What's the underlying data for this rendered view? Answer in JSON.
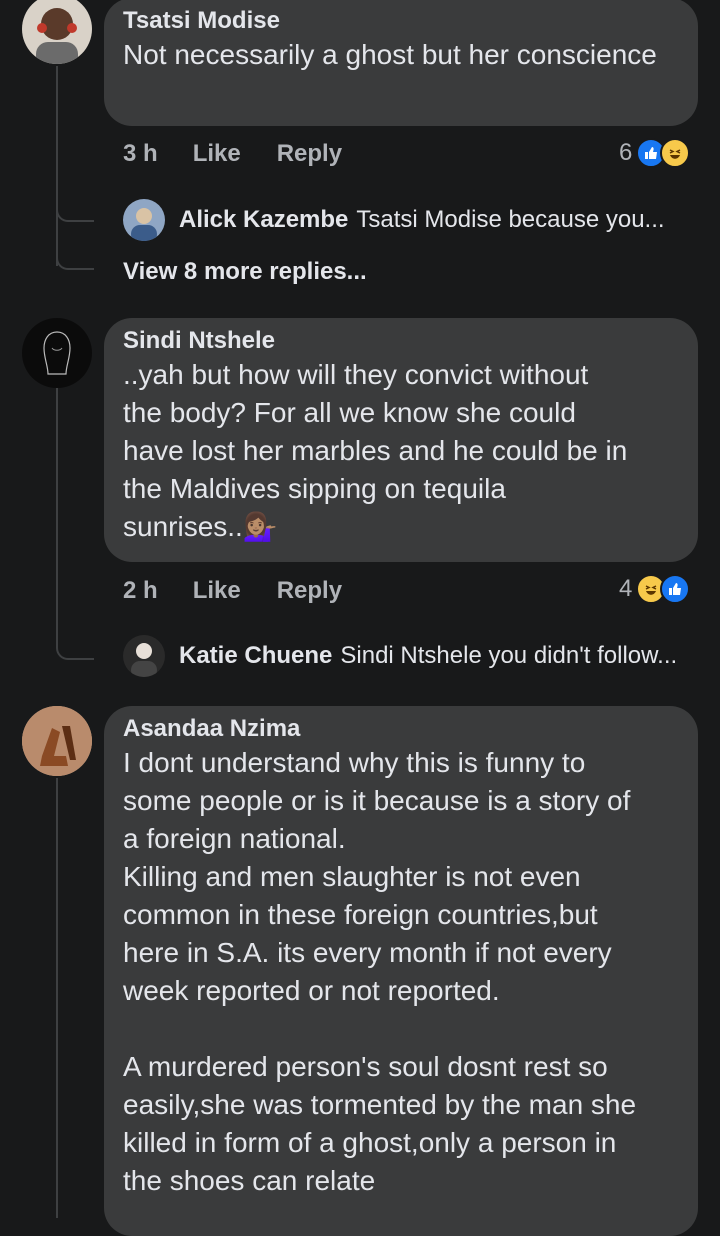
{
  "comments": [
    {
      "author": "Tsatsi Modise",
      "text": "Not necessarily a ghost but her conscience",
      "time": "3 h",
      "like": "Like",
      "reply": "Reply",
      "reaction_count": "6",
      "reactions": [
        "like-icon",
        "haha-icon"
      ],
      "reply_preview": {
        "author": "Alick Kazembe",
        "snippet": "Tsatsi Modise because you..."
      },
      "view_more": "View 8 more replies..."
    },
    {
      "author": "Sindi Ntshele",
      "text": "..yah but how will they convict without\nthe body?  For all we know she could\nhave lost her marbles and he could be in\nthe Maldives sipping on tequila\nsunrises..💁🏽‍♀️",
      "time": "2 h",
      "like": "Like",
      "reply": "Reply",
      "reaction_count": "4",
      "reactions": [
        "haha-icon",
        "like-icon"
      ],
      "reply_preview": {
        "author": "Katie Chuene",
        "snippet": "Sindi Ntshele you didn't follow..."
      }
    },
    {
      "author": "Asandaa Nzima",
      "text": "I dont understand why this is funny to\nsome people or is it because is a story of\na foreign national.\nKilling and men slaughter is not even\ncommon in these foreign countries,but\nhere in S.A. its every month if not every\nweek reported or not reported.\n\nA murdered person's soul dosnt rest so\neasily,she was tormented by the man she\nkilled in form of a ghost,only a person in\nthe shoes can relate"
    }
  ],
  "colors": {
    "background": "#18191a",
    "bubble": "#3a3b3c",
    "secondary_text": "#b0b3b8",
    "like_blue": "#1877f2",
    "haha_yellow": "#f7c94b"
  }
}
